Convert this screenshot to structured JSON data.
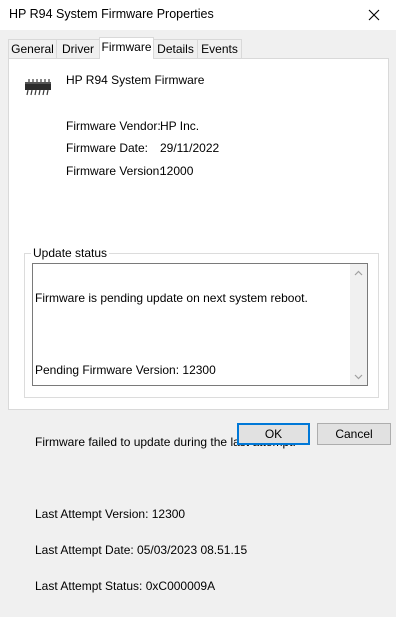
{
  "window": {
    "title": "HP R94 System Firmware Properties"
  },
  "tabs": [
    {
      "label": "General"
    },
    {
      "label": "Driver"
    },
    {
      "label": "Firmware",
      "active": true
    },
    {
      "label": "Details"
    },
    {
      "label": "Events"
    }
  ],
  "device": {
    "name": "HP R94 System Firmware",
    "icon": "chip-icon"
  },
  "properties": [
    {
      "label": "Firmware Vendor:",
      "value": "HP Inc."
    },
    {
      "label": "Firmware Date:",
      "value": "29/11/2022"
    },
    {
      "label": "Firmware Version:",
      "value": "12000"
    }
  ],
  "update_status": {
    "label": "Update status",
    "lines": [
      "Firmware is pending update on next system reboot.",
      "",
      "Pending Firmware Version: 12300",
      "",
      "Firmware failed to update during the last attempt.",
      "",
      "Last Attempt Version: 12300",
      "Last Attempt Date: 05/03/2023 08.51.15",
      "Last Attempt Status: 0xC000009A"
    ]
  },
  "buttons": {
    "ok": "OK",
    "cancel": "Cancel"
  },
  "colors": {
    "accent": "#0078d7",
    "window_bg": "#f0f0f0",
    "panel_bg": "#ffffff"
  }
}
